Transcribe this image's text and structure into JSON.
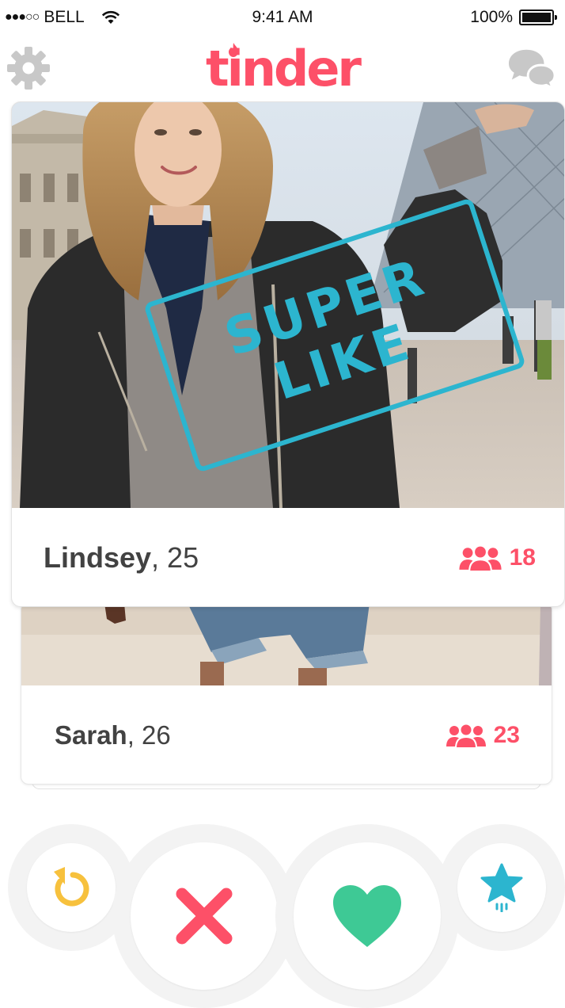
{
  "status_bar": {
    "carrier": "BELL",
    "signal": "●●●○○",
    "time": "9:41 AM",
    "battery": "100%",
    "battery_level": 1.0
  },
  "nav": {
    "logo": "tinder",
    "settings_icon": "gear-icon",
    "messages_icon": "chat-bubbles-icon"
  },
  "cards": [
    {
      "name": "Lindsey",
      "age": ", 25",
      "mutual_friends": "18",
      "stamp_line1": "SUPER",
      "stamp_line2": "LIKE"
    },
    {
      "name": "Sarah",
      "age": ", 26",
      "mutual_friends": "23"
    }
  ],
  "actions": [
    {
      "icon": "rewind-icon",
      "color": "#f7c13d"
    },
    {
      "icon": "nope-x-icon",
      "color": "#fd5068"
    },
    {
      "icon": "like-heart-icon",
      "color": "#3ec995"
    },
    {
      "icon": "super-like-star-icon",
      "color": "#2cb5cf"
    }
  ],
  "colors": {
    "brand": "#fd5068",
    "super_like": "#2cb5cf",
    "like": "#3ec995",
    "rewind": "#f7c13d"
  }
}
